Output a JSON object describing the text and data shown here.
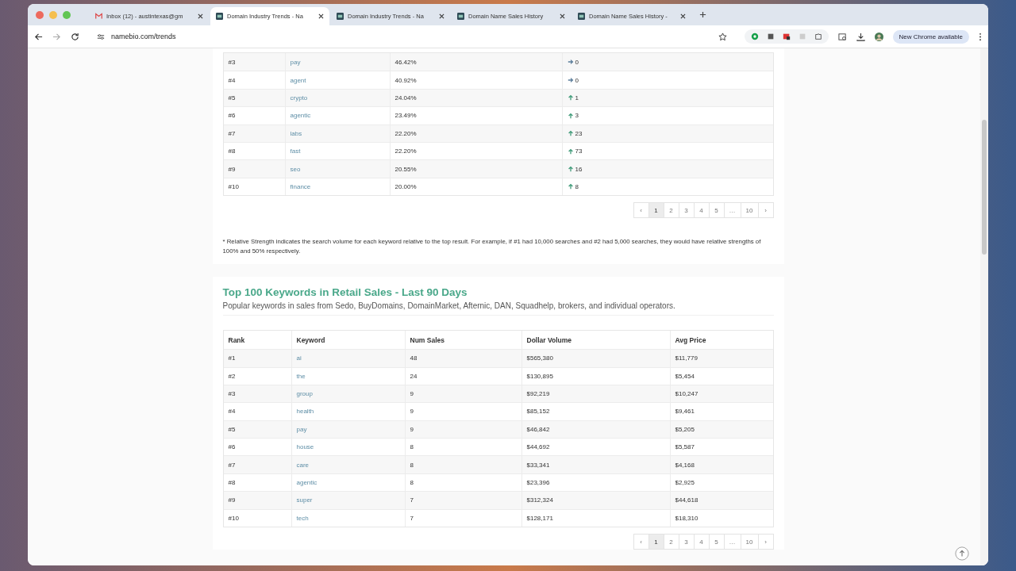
{
  "browser": {
    "tabs": [
      {
        "title": "Inbox (12) - austintexas@gm",
        "kind": "mail",
        "selected": false
      },
      {
        "title": "Domain Industry Trends - Na",
        "kind": "site",
        "selected": true
      },
      {
        "title": "Domain Industry Trends - Na",
        "kind": "site",
        "selected": false
      },
      {
        "title": "Domain Name Sales History",
        "kind": "site",
        "selected": false
      },
      {
        "title": "Domain Name Sales History -",
        "kind": "site",
        "selected": false
      }
    ],
    "url": "namebio.com/trends",
    "update_label": "New Chrome available"
  },
  "strength_table": {
    "rows": [
      {
        "rank": "#3",
        "keyword": "pay",
        "strength": "46.42%",
        "kind": "flat",
        "change": "0"
      },
      {
        "rank": "#4",
        "keyword": "agent",
        "strength": "40.92%",
        "kind": "flat",
        "change": "0"
      },
      {
        "rank": "#5",
        "keyword": "crypto",
        "strength": "24.04%",
        "kind": "up",
        "change": "1"
      },
      {
        "rank": "#6",
        "keyword": "agentic",
        "strength": "23.49%",
        "kind": "up",
        "change": "3"
      },
      {
        "rank": "#7",
        "keyword": "labs",
        "strength": "22.20%",
        "kind": "up",
        "change": "23"
      },
      {
        "rank": "#8",
        "keyword": "fast",
        "strength": "22.20%",
        "kind": "up",
        "change": "73"
      },
      {
        "rank": "#9",
        "keyword": "seo",
        "strength": "20.55%",
        "kind": "up",
        "change": "16"
      },
      {
        "rank": "#10",
        "keyword": "finance",
        "strength": "20.00%",
        "kind": "up",
        "change": "8"
      }
    ],
    "pagination": {
      "prev": "‹",
      "next": "›",
      "pages": [
        {
          "label": "1",
          "selected": true
        },
        {
          "label": "2",
          "selected": false
        },
        {
          "label": "3",
          "selected": false
        },
        {
          "label": "4",
          "selected": false
        },
        {
          "label": "5",
          "selected": false
        },
        {
          "label": "…",
          "selected": false
        },
        {
          "label": "10",
          "selected": false
        }
      ]
    },
    "footnote": "* Relative Strength indicates the search volume for each keyword relative to the top result. For example, if #1 had 10,000 searches and #2 had 5,000 searches, they would have relative strengths of 100% and 50% respectively."
  },
  "retail_section": {
    "title": "Top 100 Keywords in Retail Sales - Last 90 Days",
    "subtitle": "Popular keywords in sales from Sedo, BuyDomains, DomainMarket, Afternic, DAN, Squadhelp, brokers, and individual operators.",
    "columns": [
      "Rank",
      "Keyword",
      "Num Sales",
      "Dollar Volume",
      "Avg Price"
    ],
    "rows": [
      [
        "#1",
        "ai",
        "48",
        "$565,380",
        "$11,779"
      ],
      [
        "#2",
        "the",
        "24",
        "$130,895",
        "$5,454"
      ],
      [
        "#3",
        "group",
        "9",
        "$92,219",
        "$10,247"
      ],
      [
        "#4",
        "health",
        "9",
        "$85,152",
        "$9,461"
      ],
      [
        "#5",
        "pay",
        "9",
        "$46,842",
        "$5,205"
      ],
      [
        "#6",
        "house",
        "8",
        "$44,692",
        "$5,587"
      ],
      [
        "#7",
        "care",
        "8",
        "$33,341",
        "$4,168"
      ],
      [
        "#8",
        "agentic",
        "8",
        "$23,396",
        "$2,925"
      ],
      [
        "#9",
        "super",
        "7",
        "$312,324",
        "$44,618"
      ],
      [
        "#10",
        "tech",
        "7",
        "$128,171",
        "$18,310"
      ]
    ],
    "pagination": {
      "prev": "‹",
      "next": "›",
      "pages": [
        {
          "label": "1",
          "selected": true
        },
        {
          "label": "2",
          "selected": false
        },
        {
          "label": "3",
          "selected": false
        },
        {
          "label": "4",
          "selected": false
        },
        {
          "label": "5",
          "selected": false
        },
        {
          "label": "…",
          "selected": false
        },
        {
          "label": "10",
          "selected": false
        }
      ]
    }
  }
}
